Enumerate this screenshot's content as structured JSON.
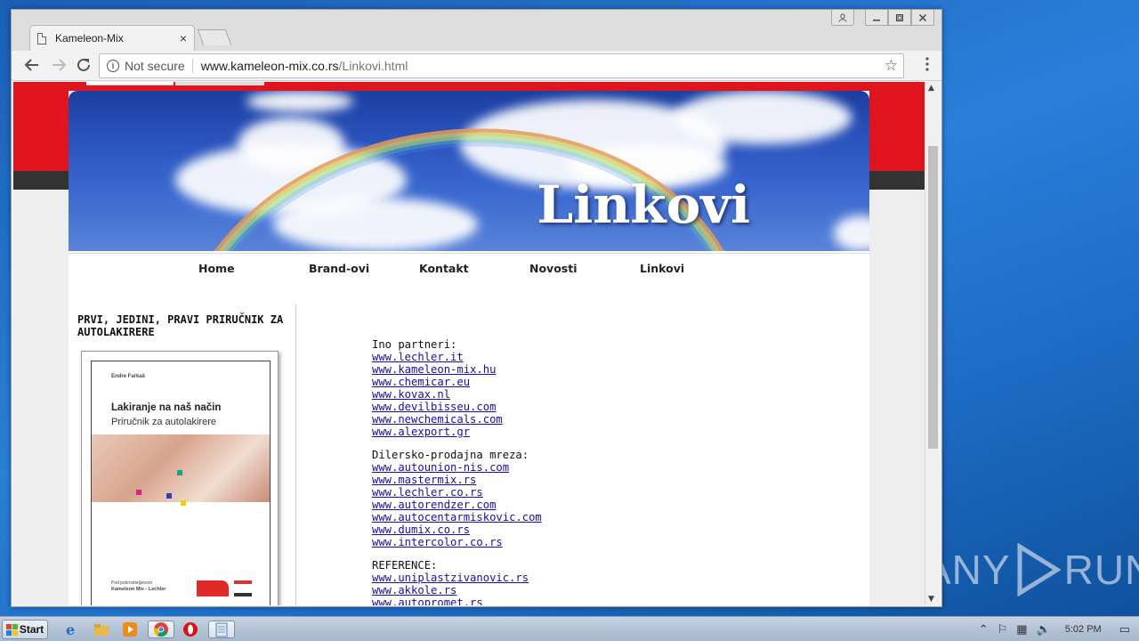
{
  "browser": {
    "tab_title": "Kameleon-Mix",
    "tab_close": "×",
    "security_label": "Not secure",
    "url_host": "www.kameleon-mix.co.rs",
    "url_path": "/Linkovi.html"
  },
  "page": {
    "banner_title": "Linkovi",
    "nav": [
      "Home",
      "Brand-ovi",
      "Kontakt",
      "Novosti",
      "Linkovi"
    ],
    "sidebar": {
      "heading": "PRVI, JEDINI, PRAVI PRIRUČNIK ZA AUTOLAKIRERE",
      "book": {
        "author": "Endre Farkaš",
        "title": "Lakiranje na naš način",
        "subtitle": "Priručnik za autolakirere",
        "publisher_line1": "Pod pokroviteljstvom",
        "publisher_line2": "Kameleon Mix - Lechler"
      }
    },
    "groups": [
      {
        "label": "Ino partneri:",
        "links": [
          "www.lechler.it",
          "www.kameleon-mix.hu",
          "www.chemicar.eu",
          "www.kovax.nl",
          "www.devilbisseu.com",
          "www.newchemicals.com",
          "www.alexport.gr"
        ]
      },
      {
        "label": "Dilersko-prodajna mreza:",
        "links": [
          "www.autounion-nis.com",
          "www.mastermix.rs",
          "www.lechler.co.rs",
          "www.autorendzer.com",
          "www.autocentarmiskovic.com",
          "www.dumix.co.rs",
          "www.intercolor.co.rs"
        ]
      },
      {
        "label": "REFERENCE:",
        "links": [
          "www.uniplastzivanovic.rs",
          "www.akkole.rs",
          "www.autopromet.rs"
        ]
      }
    ]
  },
  "taskbar": {
    "start_label": "Start",
    "clock": "5:02 PM"
  },
  "watermark": {
    "left": "ANY",
    "right": "RUN"
  }
}
